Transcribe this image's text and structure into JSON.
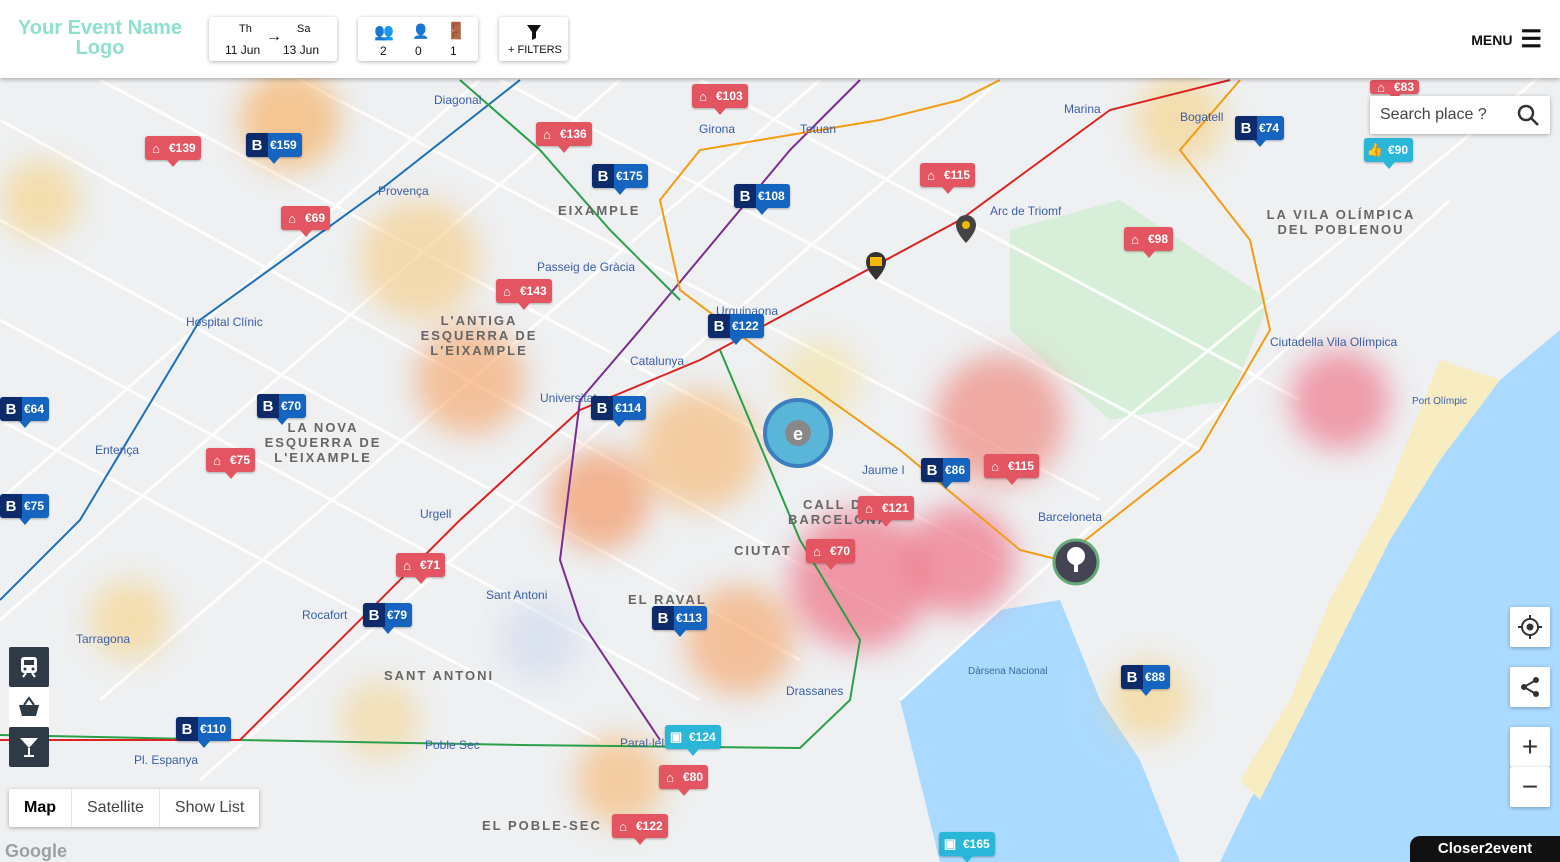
{
  "header": {
    "logo": "Your Event Name Logo",
    "dates": {
      "from_day": "Th",
      "to_day": "Sa",
      "from_date": "11 Jun",
      "to_date": "13 Jun"
    },
    "guests": {
      "adults": "2",
      "children": "0",
      "rooms": "1"
    },
    "filters_label": "+ FILTERS",
    "menu_label": "MENU"
  },
  "search": {
    "placeholder": "Search place ?"
  },
  "map_type": {
    "map": "Map",
    "satellite": "Satellite",
    "show_list": "Show List"
  },
  "brand": "Closer2event",
  "attribution": "Google",
  "districts": [
    {
      "name": "EIXAMPLE"
    },
    {
      "name": "L'ANTIGA ESQUERRA DE L'EIXAMPLE"
    },
    {
      "name": "LA NOVA ESQUERRA DE L'EIXAMPLE"
    },
    {
      "name": "LA VILA OLÍMPICA DEL POBLENOU"
    },
    {
      "name": "CIUTAT"
    },
    {
      "name": "CALL DE BARCELONA"
    },
    {
      "name": "EL RAVAL"
    },
    {
      "name": "SANT ANTONI"
    },
    {
      "name": "EL POBLE-SEC"
    }
  ],
  "stations": [
    "Diagonal",
    "Girona",
    "Tetuan",
    "Marina",
    "Bogatell",
    "Provença",
    "Passeig de Gràcia",
    "Arc de Triomf",
    "Hospital Clínic",
    "Urquinaona",
    "Catalunya",
    "Universitat",
    "Entença",
    "Jaume I",
    "Urgell",
    "Barceloneta",
    "Ciutadella Vila Olímpica",
    "Rocafort",
    "Sant Antoni",
    "Tarragona",
    "Drassanes",
    "Paral·lel",
    "Poble Sec",
    "Pl. Espanya",
    "Port Olímpic",
    "Dàrsena Nacional"
  ],
  "listings": [
    {
      "type": "airbnb",
      "price": "€103"
    },
    {
      "type": "airbnb",
      "price": "€139"
    },
    {
      "type": "booking",
      "price": "€159"
    },
    {
      "type": "airbnb",
      "price": "€136"
    },
    {
      "type": "booking",
      "price": "€175"
    },
    {
      "type": "booking",
      "price": "€108"
    },
    {
      "type": "airbnb",
      "price": "€115"
    },
    {
      "type": "booking",
      "price": "€74"
    },
    {
      "type": "other",
      "price": "€90"
    },
    {
      "type": "airbnb",
      "price": "€83"
    },
    {
      "type": "airbnb",
      "price": "€69"
    },
    {
      "type": "airbnb",
      "price": "€98"
    },
    {
      "type": "airbnb",
      "price": "€143"
    },
    {
      "type": "booking",
      "price": "€122"
    },
    {
      "type": "booking",
      "price": "€64"
    },
    {
      "type": "booking",
      "price": "€70"
    },
    {
      "type": "booking",
      "price": "€114"
    },
    {
      "type": "airbnb",
      "price": "€75"
    },
    {
      "type": "booking",
      "price": "€86"
    },
    {
      "type": "airbnb",
      "price": "€115"
    },
    {
      "type": "booking",
      "price": "€75"
    },
    {
      "type": "airbnb",
      "price": "€121"
    },
    {
      "type": "airbnb",
      "price": "€71"
    },
    {
      "type": "airbnb",
      "price": "€70"
    },
    {
      "type": "booking",
      "price": "€79"
    },
    {
      "type": "booking",
      "price": "€113"
    },
    {
      "type": "booking",
      "price": "€88"
    },
    {
      "type": "booking",
      "price": "€110"
    },
    {
      "type": "other",
      "price": "€124"
    },
    {
      "type": "airbnb",
      "price": "€80"
    },
    {
      "type": "airbnb",
      "price": "€122"
    },
    {
      "type": "other",
      "price": "€165"
    }
  ],
  "colors": {
    "airbnb": "#e45562",
    "booking": "#1565c0",
    "other": "#29b6d8",
    "sea": "#aadaff",
    "logo": "#8ee0cf"
  }
}
